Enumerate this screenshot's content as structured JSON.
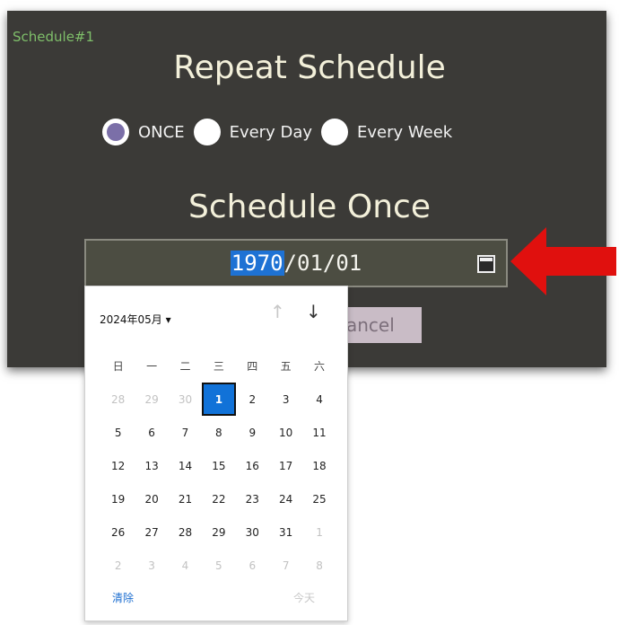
{
  "dialog": {
    "tag": "Schedule#1",
    "title": "Repeat Schedule",
    "repeat_options": [
      {
        "label": "ONCE",
        "checked": true
      },
      {
        "label": "Every Day",
        "checked": false
      },
      {
        "label": "Every Week",
        "checked": false
      }
    ],
    "subtitle": "Schedule Once",
    "date_input": {
      "year": "1970",
      "rest": "/01/01",
      "icon": "calendar-icon"
    },
    "cancel_label": "ancel"
  },
  "calendar": {
    "month_label": "2024年05月 ▾",
    "nav_up": "↑",
    "nav_down": "↓",
    "weekdays": [
      "日",
      "一",
      "二",
      "三",
      "四",
      "五",
      "六"
    ],
    "weeks": [
      [
        "28",
        "29",
        "30",
        "1",
        "2",
        "3",
        "4"
      ],
      [
        "5",
        "6",
        "7",
        "8",
        "9",
        "10",
        "11"
      ],
      [
        "12",
        "13",
        "14",
        "15",
        "16",
        "17",
        "18"
      ],
      [
        "19",
        "20",
        "21",
        "22",
        "23",
        "24",
        "25"
      ],
      [
        "26",
        "27",
        "28",
        "29",
        "30",
        "31",
        "1"
      ],
      [
        "2",
        "3",
        "4",
        "5",
        "6",
        "7",
        "8"
      ]
    ],
    "selected_day": "1",
    "clear_label": "清除",
    "today_label": "今天"
  },
  "colors": {
    "panel": "#3b3a37",
    "accent_selected": "#1172d8",
    "arrow": "#e0100e"
  }
}
